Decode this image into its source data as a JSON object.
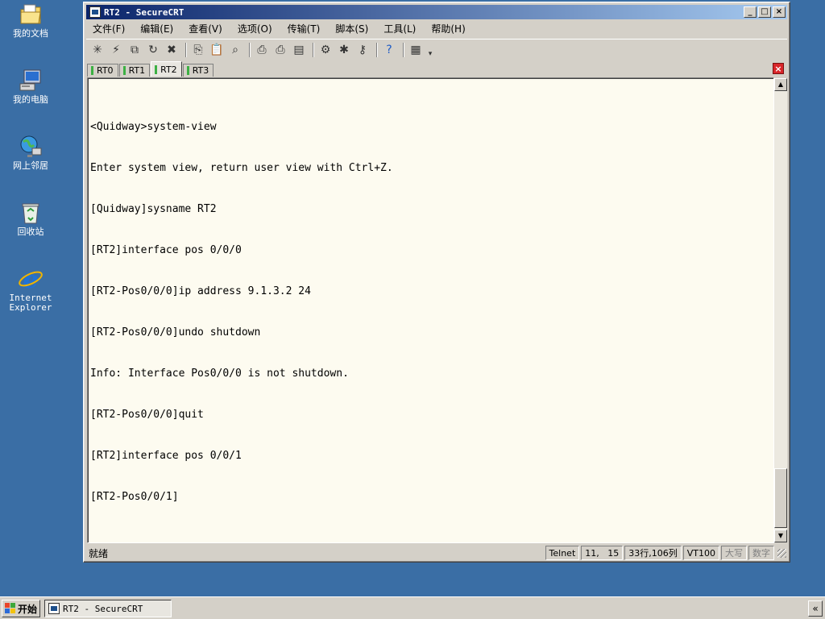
{
  "desktop": {
    "icons": [
      {
        "label": "我的文档",
        "icon": "my-documents-icon"
      },
      {
        "label": "我的电脑",
        "icon": "my-computer-icon"
      },
      {
        "label": "网上邻居",
        "icon": "network-places-icon"
      },
      {
        "label": "回收站",
        "icon": "recycle-bin-icon"
      },
      {
        "label_line1": "Internet",
        "label_line2": "Explorer",
        "icon": "internet-explorer-icon"
      }
    ]
  },
  "window": {
    "title": "RT2 - SecureCRT",
    "buttons": {
      "minimize": "_",
      "maximize": "□",
      "close": "×"
    }
  },
  "menu": {
    "items": [
      "文件(F)",
      "编辑(E)",
      "查看(V)",
      "选项(O)",
      "传输(T)",
      "脚本(S)",
      "工具(L)",
      "帮助(H)"
    ]
  },
  "tabs": {
    "items": [
      "RT0",
      "RT1",
      "RT2",
      "RT3"
    ],
    "active": "RT2"
  },
  "terminal": {
    "lines": [
      "<Quidway>system-view",
      "Enter system view, return user view with Ctrl+Z.",
      "[Quidway]sysname RT2",
      "[RT2]interface pos 0/0/0",
      "[RT2-Pos0/0/0]ip address 9.1.3.2 24",
      "[RT2-Pos0/0/0]undo shutdown",
      "Info: Interface Pos0/0/0 is not shutdown.",
      "[RT2-Pos0/0/0]quit",
      "[RT2]interface pos 0/0/1",
      "[RT2-Pos0/0/1]"
    ]
  },
  "status": {
    "ready": "就绪",
    "protocol": "Telnet",
    "cursor": "11,   15",
    "size": "33行,106列",
    "emulation": "VT100",
    "caps": "大写",
    "num": "数字"
  },
  "taskbar": {
    "start_label": "开始",
    "task_title": "RT2 - SecureCRT",
    "tray_arrow": "«"
  },
  "colors": {
    "desktop": "#3a6ea5",
    "titlebar_start": "#0a246a",
    "terminal_bg": "#fdfbf0",
    "tab_marker": "#3cb043",
    "close_tab": "#d9262a"
  }
}
